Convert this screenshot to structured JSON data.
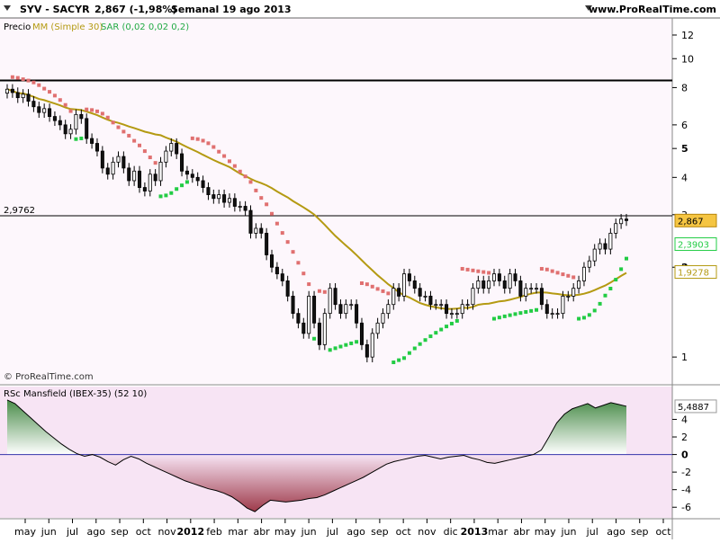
{
  "header": {
    "symbol": "SYV - SACYR",
    "last": "2,867 (-1,98%)",
    "period": "Semanal 19 ago 2013",
    "site": "www.ProRealTime.com"
  },
  "price_legend": {
    "label": "Precio",
    "ma_label": "MM (Simple 30)",
    "sar_label": "SAR (0,02 0,02 0,2)"
  },
  "watermark": "© ProRealTime.com",
  "rsc_legend": "RSc Mansfield (IBEX-35) (52 10)",
  "colors": {
    "up_candle": "#ffffff",
    "down_candle": "#111111",
    "ma": "#b49a12",
    "sar_above": "#e07070",
    "sar_below": "#22cc44",
    "rsc_pos": "#4a8c4a",
    "rsc_neg": "#9e3a4a",
    "bg_price": "#fdf7fc",
    "bg_rsc": "#f7e4f4",
    "level_label_price_bg": "#f5c542",
    "level_label_sar_bg": "#ffffff"
  },
  "chart_data": [
    {
      "type": "candlestick",
      "title": "SYV - SACYR",
      "scale": "log",
      "ylim": [
        0.83,
        13.5
      ],
      "y_ticks": [
        "12",
        "10",
        "8",
        "6",
        "5",
        "4",
        "3",
        "2",
        "1"
      ],
      "x_ticks": [
        "may",
        "jun",
        "jul",
        "ago",
        "sep",
        "oct",
        "nov",
        "2012",
        "feb",
        "mar",
        "abr",
        "may",
        "jun",
        "jul",
        "ago",
        "sep",
        "oct",
        "nov",
        "dic",
        "2013",
        "mar",
        "abr",
        "may",
        "jun",
        "jul",
        "ago",
        "sep",
        "oct"
      ],
      "horizontal_levels": [
        {
          "value": 8.45,
          "label": ""
        },
        {
          "value": 2.9762,
          "label": "2,9762"
        }
      ],
      "level_labels": [
        {
          "value": 2.867,
          "text": "2,867",
          "kind": "price"
        },
        {
          "value": 2.3903,
          "text": "2,3903",
          "kind": "sar"
        },
        {
          "value": 1.9278,
          "text": "1,9278",
          "kind": "ma"
        }
      ],
      "series_close": [
        7.9,
        7.7,
        7.4,
        7.6,
        7.2,
        6.9,
        6.6,
        6.8,
        6.4,
        6.2,
        6.0,
        5.6,
        5.8,
        6.5,
        6.3,
        5.4,
        5.2,
        4.9,
        4.3,
        4.1,
        4.5,
        4.7,
        4.3,
        3.9,
        4.2,
        3.7,
        3.6,
        4.1,
        3.9,
        4.5,
        4.9,
        5.2,
        4.8,
        4.2,
        4.1,
        4.0,
        3.9,
        3.7,
        3.5,
        3.4,
        3.5,
        3.3,
        3.4,
        3.2,
        3.2,
        3.1,
        2.6,
        2.7,
        2.6,
        2.2,
        2.0,
        1.9,
        1.8,
        1.6,
        1.4,
        1.3,
        1.2,
        1.6,
        1.3,
        1.1,
        1.4,
        1.7,
        1.5,
        1.4,
        1.5,
        1.5,
        1.3,
        1.1,
        1.0,
        1.2,
        1.3,
        1.4,
        1.5,
        1.7,
        1.6,
        1.9,
        1.8,
        1.7,
        1.6,
        1.6,
        1.5,
        1.5,
        1.5,
        1.4,
        1.4,
        1.4,
        1.5,
        1.5,
        1.7,
        1.8,
        1.7,
        1.8,
        1.9,
        1.8,
        1.7,
        1.9,
        1.8,
        1.6,
        1.7,
        1.7,
        1.7,
        1.5,
        1.4,
        1.4,
        1.4,
        1.6,
        1.6,
        1.7,
        1.8,
        2.0,
        2.1,
        2.3,
        2.4,
        2.3,
        2.6,
        2.8,
        2.9,
        2.867
      ]
    },
    {
      "type": "area",
      "title": "RSc Mansfield (IBEX-35) (52 10)",
      "ylim": [
        -7,
        6.3
      ],
      "y_ticks": [
        4,
        2,
        0,
        -2,
        -4,
        -6
      ],
      "last_label": "5,4887",
      "values": [
        6.2,
        5.8,
        5.0,
        4.2,
        3.4,
        2.6,
        1.9,
        1.2,
        0.6,
        0.1,
        -0.2,
        0.0,
        -0.3,
        -0.8,
        -1.2,
        -0.6,
        -0.2,
        -0.5,
        -1.0,
        -1.4,
        -1.8,
        -2.2,
        -2.6,
        -3.0,
        -3.3,
        -3.6,
        -3.9,
        -4.1,
        -4.4,
        -4.8,
        -5.4,
        -6.1,
        -6.5,
        -5.8,
        -5.2,
        -5.3,
        -5.4,
        -5.3,
        -5.2,
        -5.0,
        -4.9,
        -4.6,
        -4.2,
        -3.8,
        -3.4,
        -3.0,
        -2.6,
        -2.1,
        -1.6,
        -1.1,
        -0.8,
        -0.6,
        -0.4,
        -0.2,
        -0.1,
        -0.3,
        -0.5,
        -0.3,
        -0.2,
        -0.1,
        -0.4,
        -0.6,
        -0.9,
        -1.0,
        -0.8,
        -0.6,
        -0.4,
        -0.2,
        0.0,
        0.5,
        2.0,
        3.6,
        4.6,
        5.2,
        5.5,
        5.8,
        5.3,
        5.6,
        5.9,
        5.7,
        5.4887
      ]
    }
  ]
}
